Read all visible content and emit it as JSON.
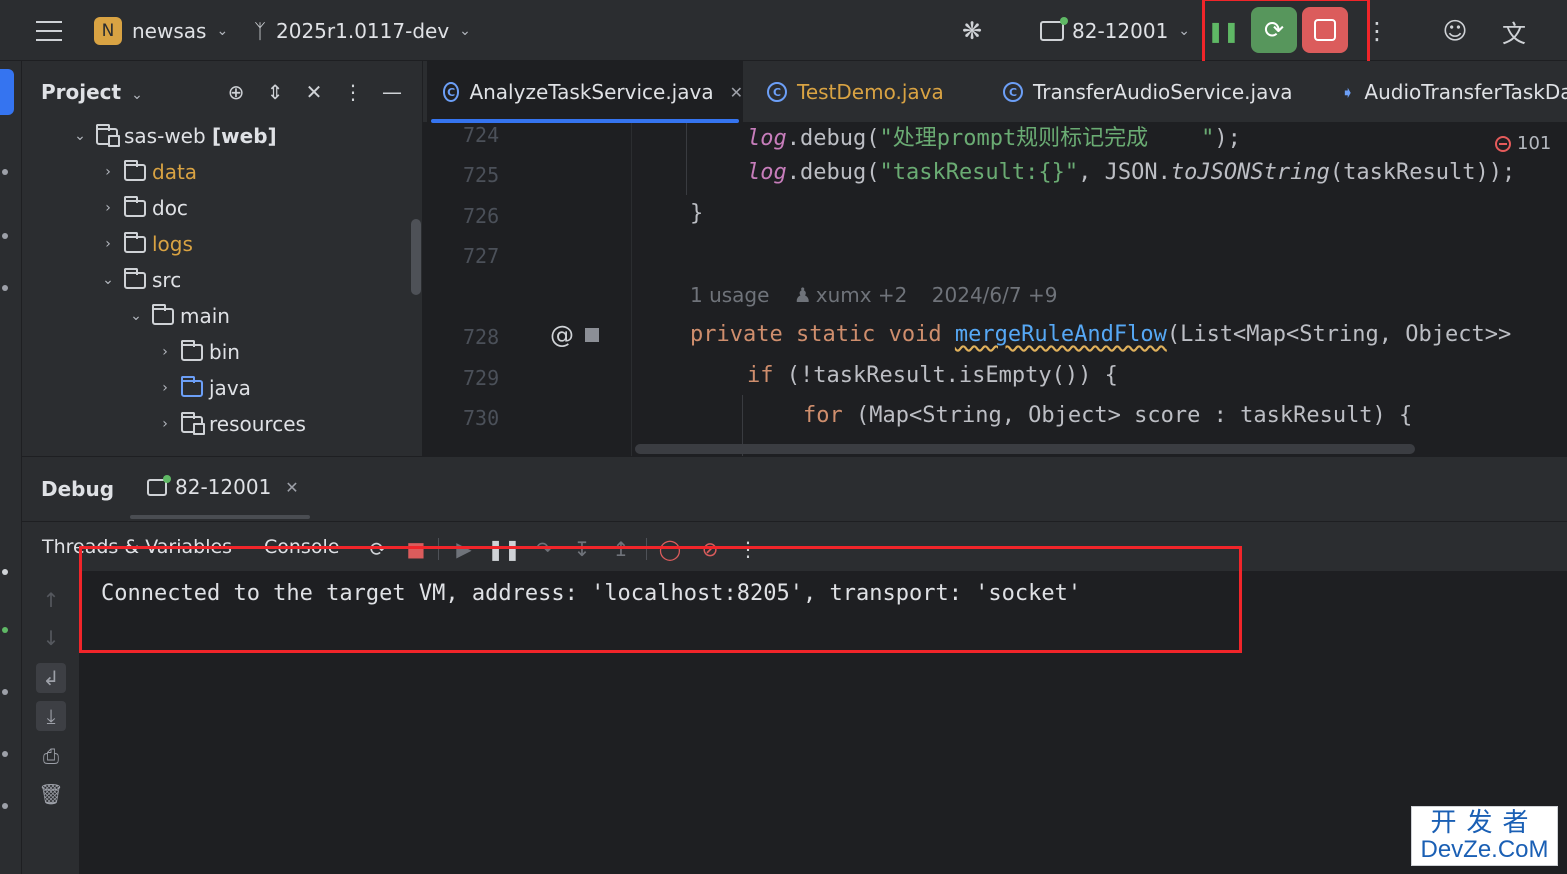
{
  "titlebar": {
    "project_badge": "N",
    "project_name": "newsas",
    "branch": "2025r1.0117-dev",
    "run_config": "82-12001"
  },
  "project_panel": {
    "title": "Project",
    "tree": [
      {
        "name": "sas-web",
        "suffix": "[web]",
        "expanded": true
      },
      {
        "name": "data"
      },
      {
        "name": "doc"
      },
      {
        "name": "logs"
      },
      {
        "name": "src",
        "expanded": true
      },
      {
        "name": "main",
        "expanded": true
      },
      {
        "name": "bin"
      },
      {
        "name": "java"
      },
      {
        "name": "resources"
      }
    ]
  },
  "editor": {
    "tabs": [
      {
        "label": "AnalyzeTaskService.java",
        "active": true
      },
      {
        "label": "TestDemo.java",
        "modified": true
      },
      {
        "label": "TransferAudioService.java"
      },
      {
        "label": "AudioTransferTaskDa"
      }
    ],
    "line_numbers": [
      "724",
      "725",
      "726",
      "727",
      "728",
      "729",
      "730"
    ],
    "lines": {
      "l724_log": "log",
      "l724_a": ".debug(",
      "l724_str": "\"处理prompt规则标记完成    \"",
      "l724_b": ");",
      "l725_log": "log",
      "l725_a": ".debug(",
      "l725_str": "\"taskResult:{}\"",
      "l725_b": ", JSON.",
      "l725_fn": "toJSONString",
      "l725_c": "(taskResult));",
      "l726": "}",
      "l728_kw": "private static void ",
      "l728_fn": "mergeRuleAndFlow",
      "l728_rest": "(List<Map<String, Object>>",
      "l729_kw": "if",
      "l729_rest": " (!taskResult.isEmpty()) {",
      "l730_kw": "for",
      "l730_rest": " (Map<String, Object> score : taskResult) {"
    },
    "inlay": {
      "usages": "1 usage",
      "author": "xumx +2",
      "date": "2024/6/7 +9"
    },
    "problems_count": "101"
  },
  "debug": {
    "title": "Debug",
    "session": "82-12001",
    "tabs": [
      "Threads & Variables",
      "Console"
    ],
    "console_output": "Connected to the target VM, address: 'localhost:8205', transport: 'socket'"
  },
  "watermark": {
    "line1": "开发者",
    "line2": "DevZe.CoM"
  },
  "colors": {
    "highlight_box": "#f1252a",
    "rerun": "#57965c",
    "stop": "#db5c5c",
    "accent": "#3574f0"
  }
}
